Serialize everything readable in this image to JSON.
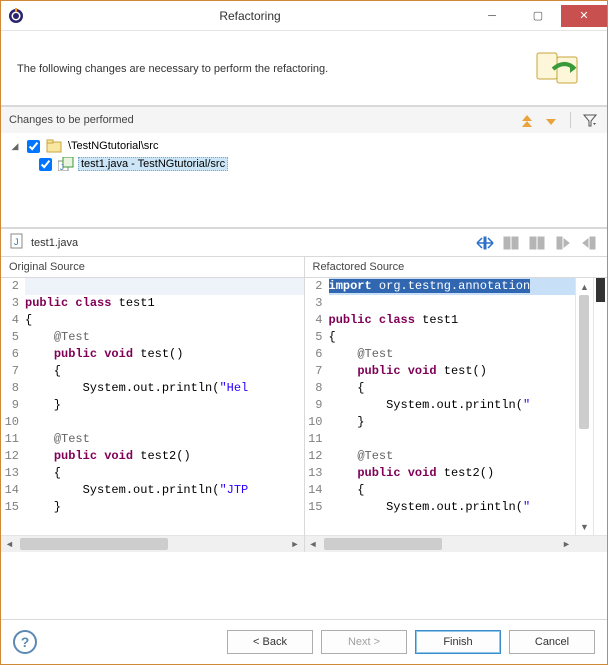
{
  "window": {
    "title": "Refactoring"
  },
  "header": {
    "message": "The following changes are necessary to perform the refactoring."
  },
  "changes": {
    "label": "Changes to be performed",
    "tree": {
      "root": {
        "label": "\\TestNGtutorial\\src"
      },
      "child": {
        "label": "test1.java - TestNGtutorial/src"
      }
    }
  },
  "file": {
    "name": "test1.java"
  },
  "compare": {
    "left_header": "Original Source",
    "right_header": "Refactored Source",
    "left_lines": [
      {
        "n": "2",
        "html": ""
      },
      {
        "n": "3",
        "html": "<span class='kw'>public</span> <span class='kw'>class</span> test1"
      },
      {
        "n": "4",
        "html": "{"
      },
      {
        "n": "5",
        "html": "    <span class='ann'>@Test</span>"
      },
      {
        "n": "6",
        "html": "    <span class='kw'>public</span> <span class='kw'>void</span> test()"
      },
      {
        "n": "7",
        "html": "    {"
      },
      {
        "n": "8",
        "html": "        System.out.println(<span class='str'>\"Hel</span>"
      },
      {
        "n": "9",
        "html": "    }"
      },
      {
        "n": "10",
        "html": ""
      },
      {
        "n": "11",
        "html": "    <span class='ann'>@Test</span>"
      },
      {
        "n": "12",
        "html": "    <span class='kw'>public</span> <span class='kw'>void</span> test2()"
      },
      {
        "n": "13",
        "html": "    {"
      },
      {
        "n": "14",
        "html": "        System.out.println(<span class='str'>\"JTP</span>"
      },
      {
        "n": "15",
        "html": "    }"
      }
    ],
    "right_lines": [
      {
        "n": "2",
        "html": "<span class='highlight-sel'><span class='kw' style='color:#fff'>import</span> org.testng.annotation</span>",
        "hl": true
      },
      {
        "n": "3",
        "html": ""
      },
      {
        "n": "4",
        "html": "<span class='kw'>public</span> <span class='kw'>class</span> test1"
      },
      {
        "n": "5",
        "html": "{"
      },
      {
        "n": "6",
        "html": "    <span class='ann'>@Test</span>"
      },
      {
        "n": "7",
        "html": "    <span class='kw'>public</span> <span class='kw'>void</span> test()"
      },
      {
        "n": "8",
        "html": "    {"
      },
      {
        "n": "9",
        "html": "        System.out.println(<span class='str'>\"</span>"
      },
      {
        "n": "10",
        "html": "    }"
      },
      {
        "n": "11",
        "html": ""
      },
      {
        "n": "12",
        "html": "    <span class='ann'>@Test</span>"
      },
      {
        "n": "13",
        "html": "    <span class='kw'>public</span> <span class='kw'>void</span> test2()"
      },
      {
        "n": "14",
        "html": "    {"
      },
      {
        "n": "15",
        "html": "        System.out.println(<span class='str'>\"</span>"
      }
    ]
  },
  "buttons": {
    "back": "< Back",
    "next": "Next >",
    "finish": "Finish",
    "cancel": "Cancel"
  }
}
